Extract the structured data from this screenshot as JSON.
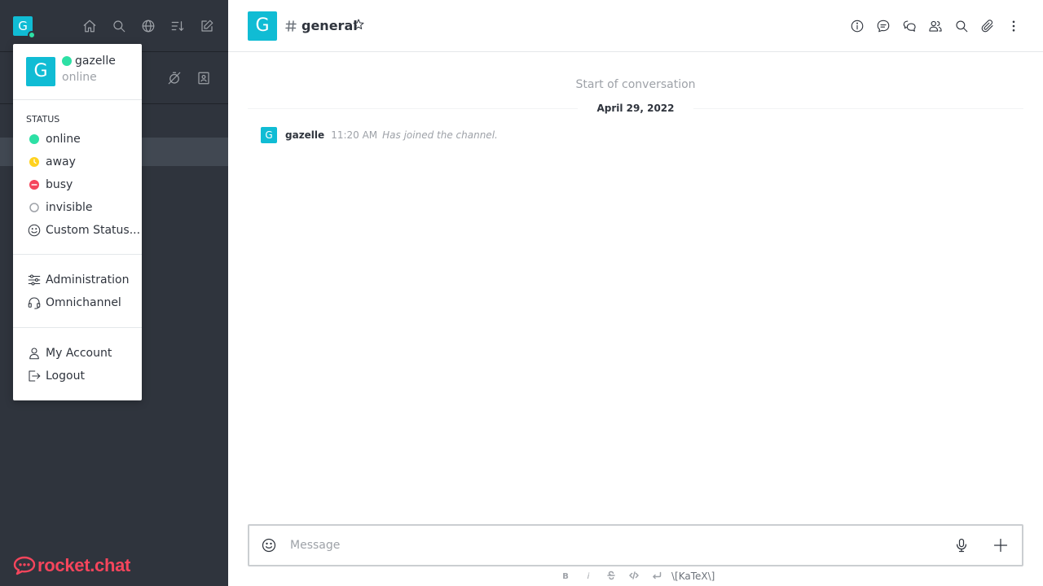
{
  "colors": {
    "sidebar_bg": "#2f343d",
    "avatar_bg": "#10bcd4",
    "online": "#2de0a5",
    "away": "#ffd21f",
    "busy": "#f5455c",
    "brand": "#f5455c"
  },
  "sidebar": {
    "avatar_letter": "G",
    "top_icons": [
      "home-icon",
      "directory-search-icon",
      "globe-icon",
      "sort-icon",
      "create-new-icon"
    ],
    "logo_text": "rocket.chat"
  },
  "user_menu": {
    "avatar_letter": "G",
    "username": "gazelle",
    "status": "online",
    "status_title": "Status",
    "statuses": [
      {
        "label": "online",
        "icon": "online-dot-icon"
      },
      {
        "label": "away",
        "icon": "away-clock-icon"
      },
      {
        "label": "busy",
        "icon": "busy-minus-icon"
      },
      {
        "label": "invisible",
        "icon": "invisible-ring-icon"
      },
      {
        "label": "Custom Status...",
        "icon": "smiley-icon"
      }
    ],
    "admin_items": [
      {
        "label": "Administration",
        "icon": "sliders-icon"
      },
      {
        "label": "Omnichannel",
        "icon": "headset-icon"
      }
    ],
    "account_items": [
      {
        "label": "My Account",
        "icon": "user-icon"
      },
      {
        "label": "Logout",
        "icon": "logout-icon"
      }
    ]
  },
  "room": {
    "avatar_letter": "G",
    "name": "general",
    "header_actions": [
      "info-icon",
      "discussion-icon",
      "threads-icon",
      "members-icon",
      "search-icon",
      "attachment-icon",
      "kebab-menu-icon"
    ]
  },
  "conversation": {
    "start_label": "Start of conversation",
    "date_separator": "April 29, 2022",
    "messages": [
      {
        "avatar_letter": "G",
        "user": "gazelle",
        "time": "11:20 AM",
        "text": "Has joined the channel."
      }
    ]
  },
  "composer": {
    "placeholder": "Message",
    "formatting": {
      "bold": "B",
      "italic": "i",
      "katex": "\\[KaTeX\\]"
    }
  }
}
